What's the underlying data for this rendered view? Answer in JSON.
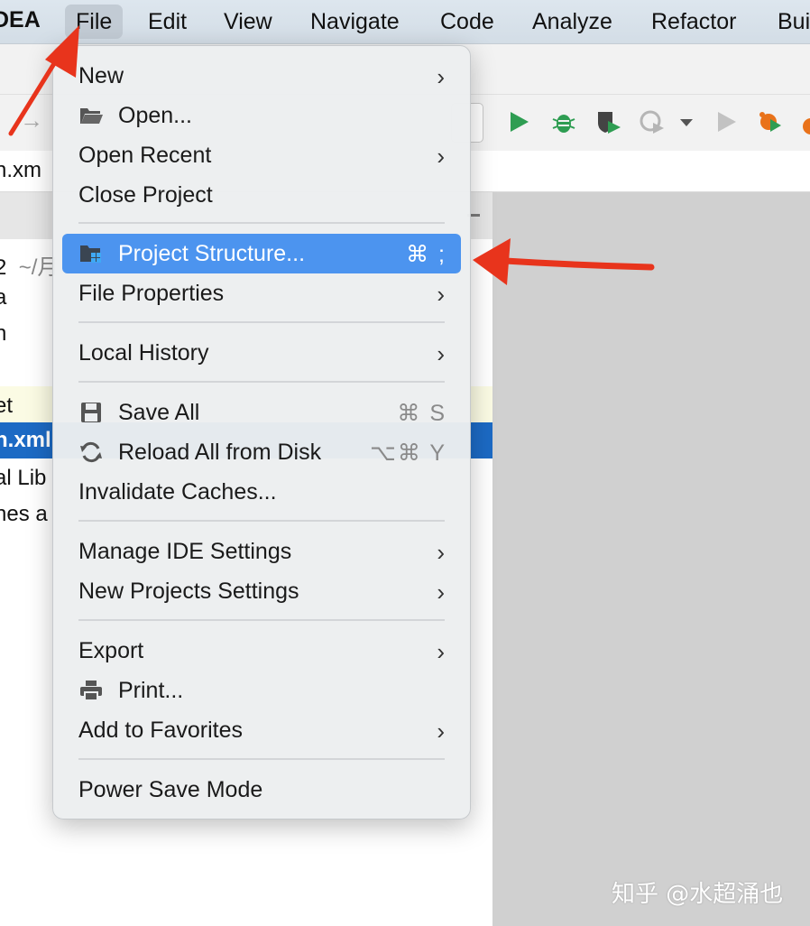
{
  "menubar": {
    "app_name": "DEA",
    "items": [
      "File",
      "Edit",
      "View",
      "Navigate",
      "Code",
      "Analyze",
      "Refactor",
      "Bui"
    ]
  },
  "editor": {
    "tab_text": "n.xm",
    "tree": [
      {
        "text": "2",
        "dim": "~/月"
      },
      {
        "text": "a"
      },
      {
        "text": "n"
      },
      {
        "text": "et"
      },
      {
        "text": "n.xml"
      },
      {
        "text": "al Lib"
      },
      {
        "text": "hes a"
      }
    ]
  },
  "file_menu": {
    "items": [
      {
        "label": "New",
        "submenu": true
      },
      {
        "label": "Open...",
        "icon": "folder-open-icon"
      },
      {
        "label": "Open Recent",
        "submenu": true
      },
      {
        "label": "Close Project"
      },
      {
        "label": "Project Structure...",
        "icon": "project-structure-icon",
        "shortcut": "⌘ ;",
        "selected": true
      },
      {
        "label": "File Properties",
        "submenu": true
      },
      {
        "label": "Local History",
        "submenu": true
      },
      {
        "label": "Save All",
        "icon": "save-icon",
        "shortcut": "⌘ S"
      },
      {
        "label": "Reload All from Disk",
        "icon": "reload-icon",
        "shortcut": "⌥⌘ Y"
      },
      {
        "label": "Invalidate Caches..."
      },
      {
        "label": "Manage IDE Settings",
        "submenu": true
      },
      {
        "label": "New Projects Settings",
        "submenu": true
      },
      {
        "label": "Export",
        "submenu": true
      },
      {
        "label": "Print...",
        "icon": "printer-icon"
      },
      {
        "label": "Add to Favorites",
        "submenu": true
      },
      {
        "label": "Power Save Mode"
      }
    ]
  },
  "watermark": "知乎 @水超涌也",
  "colors": {
    "selection": "#4c94ef",
    "annotation_arrow": "#e8341c",
    "run_green": "#2e9d52",
    "tree_selection": "#1c6ac4"
  }
}
